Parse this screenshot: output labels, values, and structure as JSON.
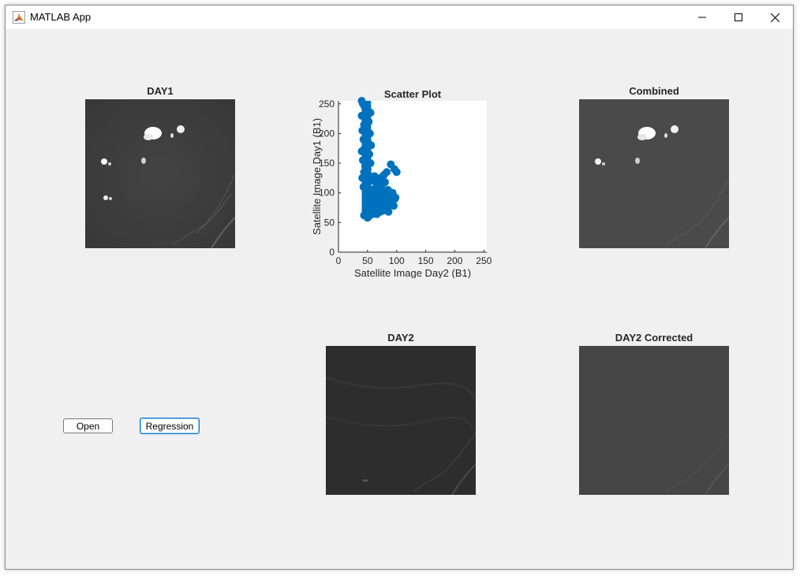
{
  "window": {
    "title": "MATLAB App",
    "icon": "matlab-icon"
  },
  "controls": {
    "minimize": "minimize-icon",
    "maximize": "maximize-icon",
    "close": "close-icon"
  },
  "panels": {
    "day1": {
      "title": "DAY1"
    },
    "combined": {
      "title": "Combined"
    },
    "day2": {
      "title": "DAY2"
    },
    "day2_corrected": {
      "title": "DAY2 Corrected"
    }
  },
  "buttons": {
    "open": "Open",
    "regression": "Regression"
  },
  "colors": {
    "window_bg": "#f0f0f0",
    "scatter": "#0072bd",
    "focus": "#0078d7"
  },
  "chart_data": {
    "type": "scatter",
    "title": "Scatter Plot",
    "xlabel": "Satellite Image Day2 (B1)",
    "ylabel": "Satellite Image Day1 (B1)",
    "xlim": [
      0,
      255
    ],
    "ylim": [
      0,
      255
    ],
    "xticks": [
      0,
      50,
      100,
      150,
      200,
      250
    ],
    "yticks": [
      0,
      50,
      100,
      150,
      200,
      250
    ],
    "grid": false,
    "series": [
      {
        "points": [
          [
            40,
            255
          ],
          [
            42,
            250
          ],
          [
            45,
            245
          ],
          [
            50,
            240
          ],
          [
            55,
            235
          ],
          [
            40,
            230
          ],
          [
            46,
            225
          ],
          [
            52,
            220
          ],
          [
            44,
            215
          ],
          [
            49,
            210
          ],
          [
            41,
            205
          ],
          [
            54,
            200
          ],
          [
            47,
            195
          ],
          [
            43,
            190
          ],
          [
            51,
            185
          ],
          [
            56,
            180
          ],
          [
            45,
            175
          ],
          [
            40,
            170
          ],
          [
            53,
            165
          ],
          [
            48,
            160
          ],
          [
            42,
            155
          ],
          [
            55,
            150
          ],
          [
            46,
            145
          ],
          [
            50,
            140
          ],
          [
            44,
            135
          ],
          [
            52,
            130
          ],
          [
            41,
            125
          ],
          [
            57,
            120
          ],
          [
            47,
            115
          ],
          [
            43,
            110
          ],
          [
            60,
            106
          ],
          [
            65,
            100
          ],
          [
            70,
            104
          ],
          [
            75,
            98
          ],
          [
            80,
            95
          ],
          [
            85,
            102
          ],
          [
            90,
            92
          ],
          [
            62,
            90
          ],
          [
            68,
            88
          ],
          [
            72,
            85
          ],
          [
            78,
            82
          ],
          [
            84,
            86
          ],
          [
            88,
            80
          ],
          [
            92,
            88
          ],
          [
            95,
            78
          ],
          [
            58,
            78
          ],
          [
            64,
            75
          ],
          [
            70,
            72
          ],
          [
            76,
            70
          ],
          [
            82,
            74
          ],
          [
            86,
            68
          ],
          [
            56,
            70
          ],
          [
            60,
            66
          ],
          [
            66,
            64
          ],
          [
            72,
            68
          ],
          [
            48,
            62
          ],
          [
            52,
            60
          ],
          [
            58,
            64
          ],
          [
            44,
            62
          ],
          [
            50,
            58
          ],
          [
            70,
            110
          ],
          [
            75,
            115
          ],
          [
            80,
            118
          ],
          [
            72,
            125
          ],
          [
            78,
            130
          ],
          [
            83,
            135
          ],
          [
            66,
            120
          ],
          [
            90,
            148
          ],
          [
            96,
            140
          ],
          [
            100,
            135
          ],
          [
            98,
            92
          ],
          [
            85,
            105
          ],
          [
            62,
            128
          ],
          [
            66,
            112
          ],
          [
            74,
            95
          ],
          [
            88,
            96
          ],
          [
            93,
            100
          ],
          [
            91,
            84
          ],
          [
            97,
            90
          ],
          [
            54,
            95
          ]
        ]
      }
    ]
  }
}
